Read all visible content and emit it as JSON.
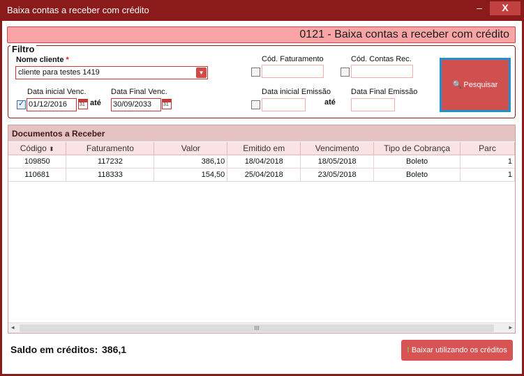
{
  "window": {
    "title": "Baixa contas a receber com crédito",
    "minimize": "–",
    "close": "X"
  },
  "header": {
    "title": "0121 - Baixa contas a receber com crédito"
  },
  "filtro": {
    "legend": "Filtro",
    "nome_cliente": {
      "label": "Nome cliente",
      "required_mark": "*",
      "value": "cliente para testes 1419"
    },
    "cod_faturamento": {
      "label": "Cód. Faturamento",
      "value": "",
      "checked": false
    },
    "cod_contas_rec": {
      "label": "Cód. Contas Rec.",
      "value": "",
      "checked": false
    },
    "data_inicial_venc": {
      "label": "Data inicial Venc.",
      "value": "01/12/2016",
      "checked": true
    },
    "ate1": "até",
    "data_final_venc": {
      "label": "Data Final Venc.",
      "value": "30/09/2033"
    },
    "data_inicial_emissao": {
      "label": "Data inicial Emissão",
      "value": "",
      "checked": false
    },
    "ate2": "até",
    "data_final_emissao": {
      "label": "Data Final Emissão",
      "value": ""
    },
    "calendar_glyph": "31",
    "pesquisar_label": "Pesquisar",
    "pesquisar_icon": "search-icon"
  },
  "documentos": {
    "title": "Documentos a Receber",
    "columns": [
      "Código",
      "Faturamento",
      "Valor",
      "Emitido em",
      "Vencimento",
      "Tipo de Cobrança",
      "Parc"
    ],
    "sort_glyph": "⬍",
    "rows": [
      [
        "109850",
        "117232",
        "386,10",
        "18/04/2018",
        "18/05/2018",
        "Boleto",
        "1"
      ],
      [
        "110681",
        "118333",
        "154,50",
        "25/04/2018",
        "23/05/2018",
        "Boleto",
        "1"
      ]
    ],
    "scroll_left": "◂",
    "scroll_right": "▸",
    "scroll_grip": "III"
  },
  "footer": {
    "saldo_label": "Saldo em créditos:",
    "saldo_value": "386,1",
    "baixar_label": "Baixar utilizando os créditos",
    "baixar_icon": "!"
  },
  "colors": {
    "window": "#8b1a1a",
    "accent": "#d05050",
    "header": "#f9a5a5",
    "focus": "#1e90d0"
  }
}
